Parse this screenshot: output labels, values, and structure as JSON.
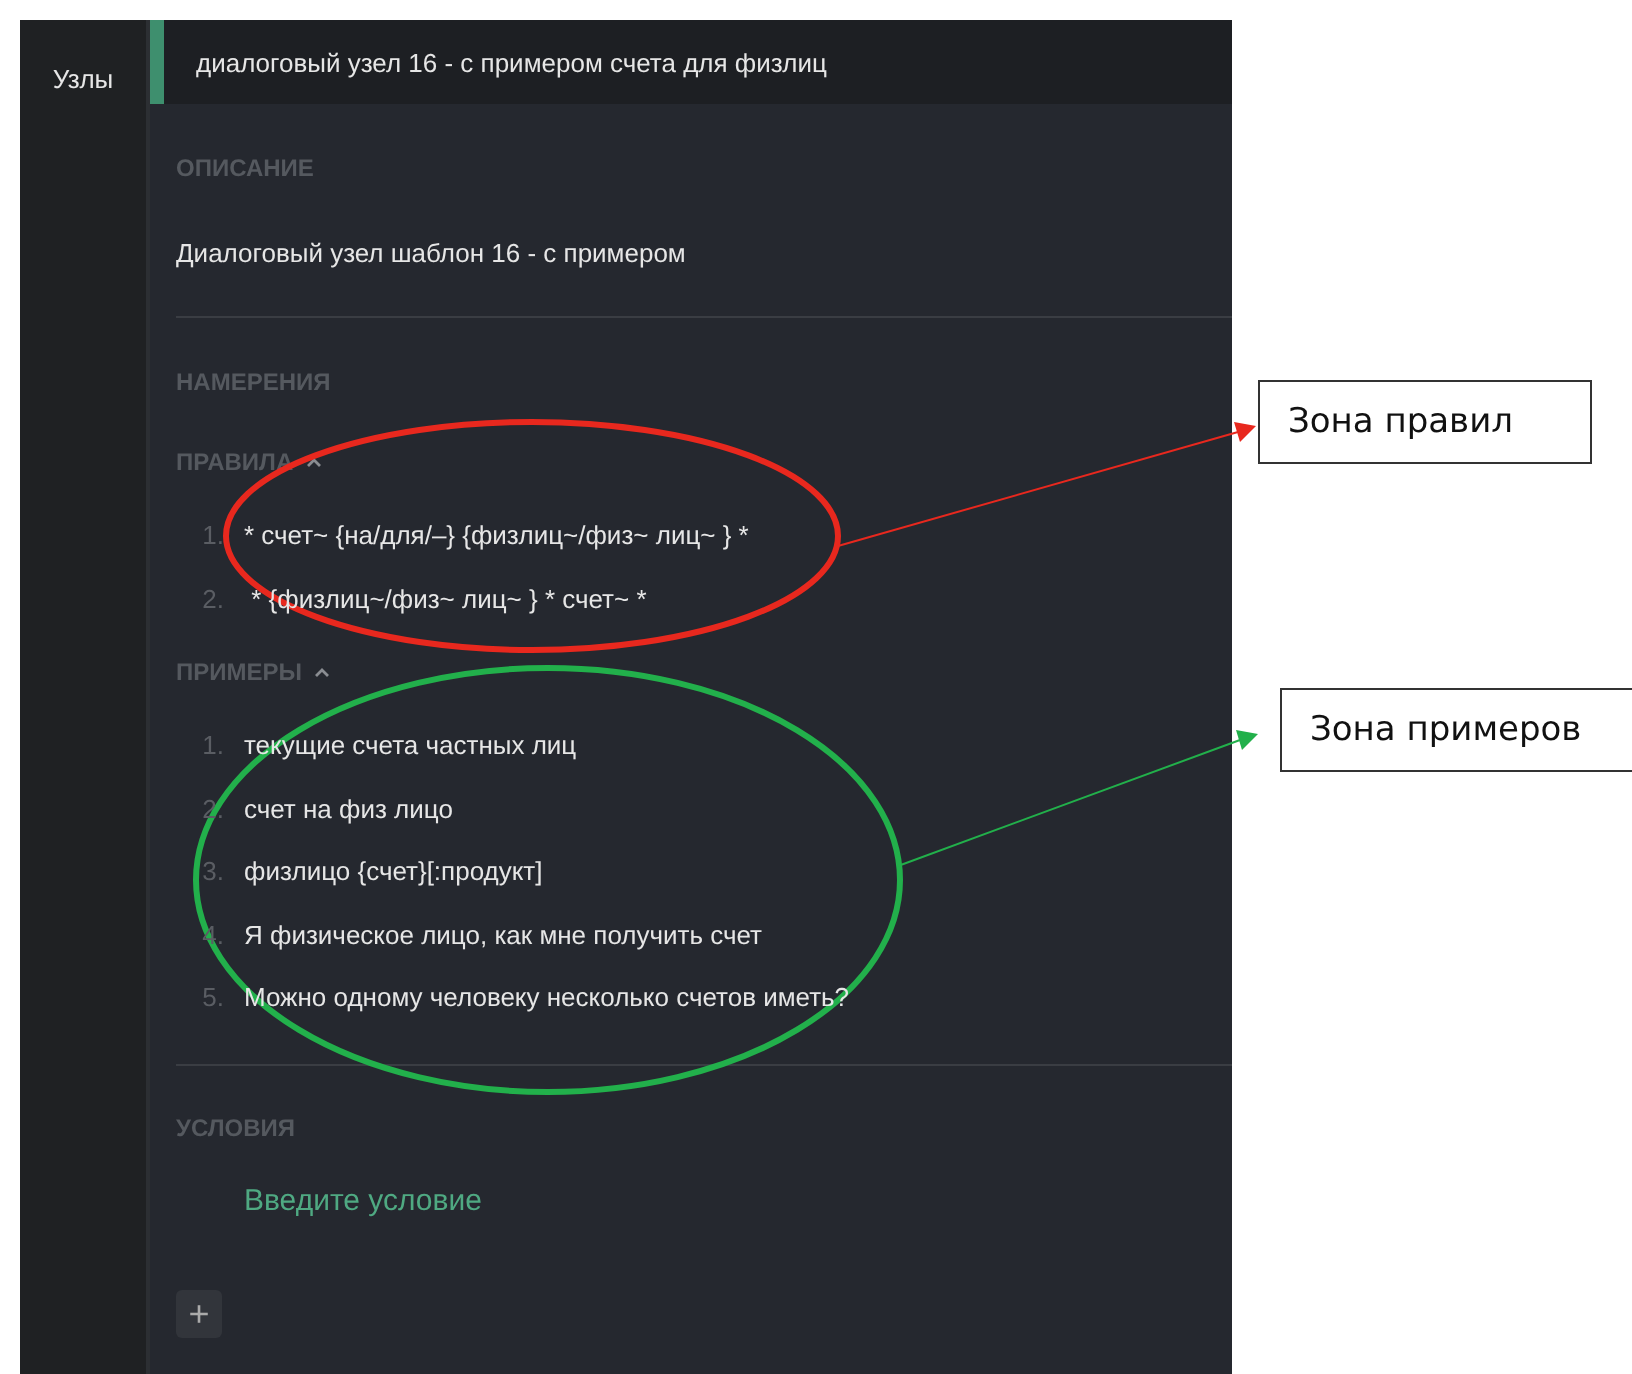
{
  "sidebar": {
    "label": "Узлы"
  },
  "header": {
    "title": "диалоговый узел 16 - с примером счета для физлиц"
  },
  "description": {
    "heading": "ОПИСАНИЕ",
    "text": "Диалоговый узел шаблон 16 - с примером"
  },
  "intents": {
    "heading": "НАМЕРЕНИЯ"
  },
  "rules": {
    "heading": "ПРАВИЛА",
    "expanded": true,
    "items": [
      {
        "number": "1.",
        "text": "* счет~ {на/для/–} {физлиц~/физ~ лиц~ } *"
      },
      {
        "number": "2.",
        "text": " * {физлиц~/физ~ лиц~ } * счет~ *"
      }
    ]
  },
  "examples": {
    "heading": "ПРИМЕРЫ",
    "expanded": true,
    "items": [
      {
        "number": "1.",
        "text": "текущие счета частных лиц"
      },
      {
        "number": "2.",
        "text": "счет на физ лицо"
      },
      {
        "number": "3.",
        "text": "физлицо {счет}[:продукт]"
      },
      {
        "number": "4.",
        "text": "Я физическое лицо, как мне получить счет"
      },
      {
        "number": "5.",
        "text": "Можно одному человеку несколько счетов иметь?"
      }
    ]
  },
  "conditions": {
    "heading": "УСЛОВИЯ",
    "placeholder": "Введите условие",
    "add_button": "+"
  },
  "annotations": [
    {
      "label": "Зона правил",
      "color": "#e8281e"
    },
    {
      "label": "Зона примеров",
      "color": "#22b04b"
    }
  ]
}
